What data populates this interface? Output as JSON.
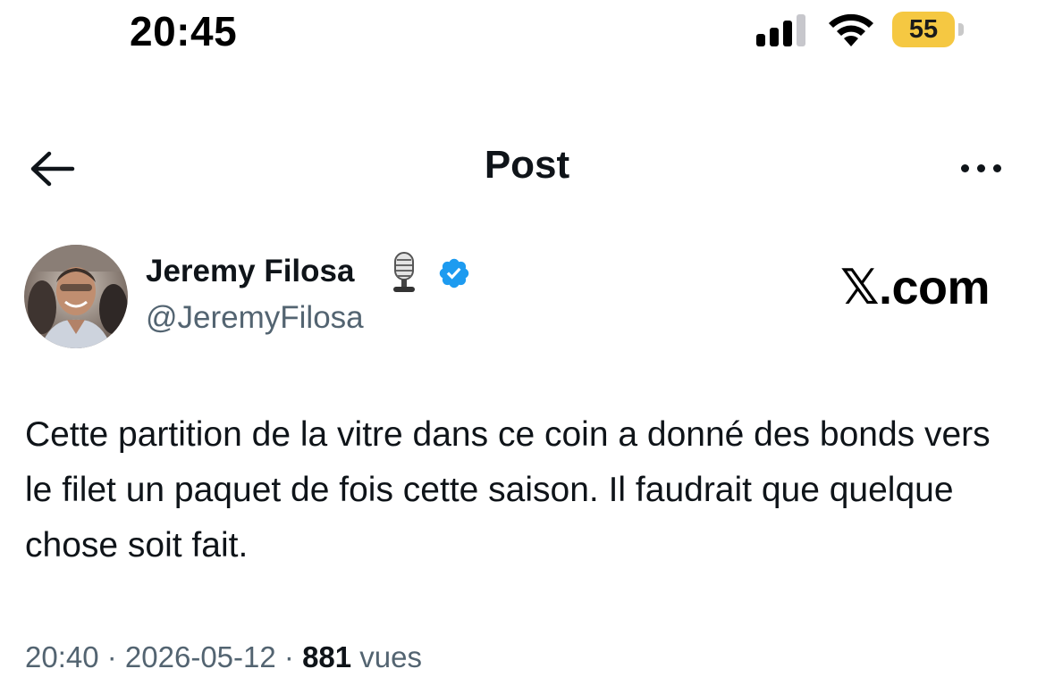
{
  "status_bar": {
    "time": "20:45",
    "battery_level": "55",
    "battery_color": "#f5c842"
  },
  "header": {
    "title": "Post",
    "back_icon": "arrow-left-icon",
    "more_icon": "more-horizontal-icon"
  },
  "author": {
    "name": "Jeremy Filosa",
    "handle": "@JeremyFilosa",
    "emoji": "studio-microphone",
    "verified": true,
    "verified_color": "#1d9bf0"
  },
  "watermark": "𝕏.com",
  "tweet": {
    "text": "Cette partition de la vitre dans ce coin a donné des bonds vers le filet un paquet de fois cette saison. Il faudrait que quelque chose soit fait."
  },
  "meta": {
    "time": "20:40",
    "separator": " · ",
    "date": "2026-05-12",
    "views_count": "881",
    "views_label": "vues"
  }
}
